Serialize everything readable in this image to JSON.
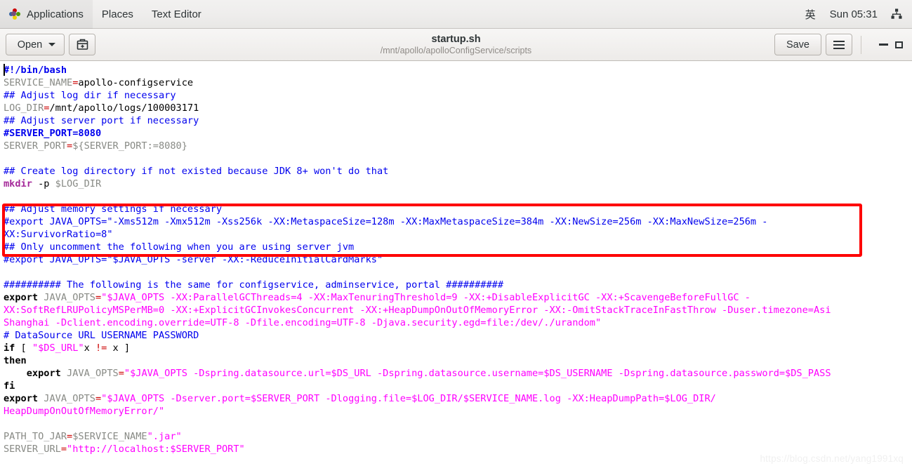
{
  "topbar": {
    "logo_icon": "gnome-footprint-icon",
    "applications": "Applications",
    "places": "Places",
    "app_name": "Text Editor",
    "input_method": "英",
    "clock": "Sun 05:31",
    "network_icon": "network-wired-icon"
  },
  "headerbar": {
    "open_label": "Open",
    "open_caret_icon": "chevron-down-icon",
    "open_recent_icon": "open-recent-document-icon",
    "title": "startup.sh",
    "subtitle": "/mnt/apollo/apolloConfigService/scripts",
    "save_label": "Save",
    "menu_icon": "hamburger-menu-icon",
    "minimize_icon": "minimize-icon",
    "maximize_icon": "maximize-icon"
  },
  "editor": {
    "lines": [
      [
        {
          "t": "#!/bin/bash",
          "c": "cmtb"
        }
      ],
      [
        {
          "t": "SERVICE_NAME",
          "c": "var"
        },
        {
          "t": "=",
          "c": "op"
        },
        {
          "t": "apollo-configservice",
          "c": "plain"
        }
      ],
      [
        {
          "t": "## Adjust log dir if necessary",
          "c": "cmt"
        }
      ],
      [
        {
          "t": "LOG_DIR",
          "c": "var"
        },
        {
          "t": "=",
          "c": "op"
        },
        {
          "t": "/mnt/apollo/logs/100003171",
          "c": "plain"
        }
      ],
      [
        {
          "t": "## Adjust server port if necessary",
          "c": "cmt"
        }
      ],
      [
        {
          "t": "#SERVER_PORT=8080",
          "c": "cmtb"
        }
      ],
      [
        {
          "t": "SERVER_PORT",
          "c": "var"
        },
        {
          "t": "=",
          "c": "op"
        },
        {
          "t": "${SERVER_PORT:=8080}",
          "c": "var"
        }
      ],
      [],
      [
        {
          "t": "## Create log directory if not existed because JDK 8+ won't do that",
          "c": "cmt"
        }
      ],
      [
        {
          "t": "mkdir",
          "c": "bi"
        },
        {
          "t": " -p ",
          "c": "plain"
        },
        {
          "t": "$LOG_DIR",
          "c": "var"
        }
      ],
      [],
      [
        {
          "t": "## Adjust memory settings if necessary",
          "c": "cmt"
        }
      ],
      [
        {
          "t": "#export JAVA_OPTS=\"-Xms512m -Xmx512m -Xss256k -XX:MetaspaceSize=128m -XX:MaxMetaspaceSize=384m -XX:NewSize=256m -XX:MaxNewSize=256m -",
          "c": "cmt"
        }
      ],
      [
        {
          "t": "XX:SurvivorRatio=8\"",
          "c": "cmt"
        }
      ],
      [
        {
          "t": "## Only uncomment the following when you are using server jvm",
          "c": "cmt"
        }
      ],
      [
        {
          "t": "#export JAVA_OPTS=\"$JAVA_OPTS -server -XX:-ReduceInitialCardMarks\"",
          "c": "cmt"
        }
      ],
      [],
      [
        {
          "t": "########## The following is the same for configservice, adminservice, portal ##########",
          "c": "cmt"
        }
      ],
      [
        {
          "t": "export",
          "c": "kw"
        },
        {
          "t": " ",
          "c": "plain"
        },
        {
          "t": "JAVA_OPTS",
          "c": "var"
        },
        {
          "t": "=",
          "c": "op"
        },
        {
          "t": "\"$JAVA_OPTS -XX:ParallelGCThreads=4 -XX:MaxTenuringThreshold=9 -XX:+DisableExplicitGC -XX:+ScavengeBeforeFullGC -",
          "c": "str"
        }
      ],
      [
        {
          "t": "XX:SoftRefLRUPolicyMSPerMB=0 -XX:+ExplicitGCInvokesConcurrent -XX:+HeapDumpOnOutOfMemoryError -XX:-OmitStackTraceInFastThrow -Duser.timezone=Asi",
          "c": "str"
        }
      ],
      [
        {
          "t": "Shanghai -Dclient.encoding.override=UTF-8 -Dfile.encoding=UTF-8 -Djava.security.egd=file:/dev/./urandom\"",
          "c": "str"
        }
      ],
      [
        {
          "t": "# DataSource URL USERNAME PASSWORD",
          "c": "cmt"
        }
      ],
      [
        {
          "t": "if",
          "c": "kw"
        },
        {
          "t": " [ ",
          "c": "plain"
        },
        {
          "t": "\"$DS_URL\"",
          "c": "str"
        },
        {
          "t": "x ",
          "c": "plain"
        },
        {
          "t": "!=",
          "c": "op"
        },
        {
          "t": " x ]",
          "c": "plain"
        }
      ],
      [
        {
          "t": "then",
          "c": "kw"
        }
      ],
      [
        {
          "t": "    export",
          "c": "kw"
        },
        {
          "t": " ",
          "c": "plain"
        },
        {
          "t": "JAVA_OPTS",
          "c": "var"
        },
        {
          "t": "=",
          "c": "op"
        },
        {
          "t": "\"$JAVA_OPTS -Dspring.datasource.url=$DS_URL -Dspring.datasource.username=$DS_USERNAME -Dspring.datasource.password=$DS_PASS",
          "c": "str"
        }
      ],
      [
        {
          "t": "fi",
          "c": "kw"
        }
      ],
      [
        {
          "t": "export",
          "c": "kw"
        },
        {
          "t": " ",
          "c": "plain"
        },
        {
          "t": "JAVA_OPTS",
          "c": "var"
        },
        {
          "t": "=",
          "c": "op"
        },
        {
          "t": "\"$JAVA_OPTS -Dserver.port=$SERVER_PORT -Dlogging.file=$LOG_DIR/$SERVICE_NAME.log -XX:HeapDumpPath=$LOG_DIR/",
          "c": "str"
        }
      ],
      [
        {
          "t": "HeapDumpOnOutOfMemoryError/\"",
          "c": "str"
        }
      ],
      [],
      [
        {
          "t": "PATH_TO_JAR",
          "c": "var"
        },
        {
          "t": "=",
          "c": "op"
        },
        {
          "t": "$SERVICE_NAME",
          "c": "var"
        },
        {
          "t": "\".jar\"",
          "c": "str"
        }
      ],
      [
        {
          "t": "SERVER_URL",
          "c": "var"
        },
        {
          "t": "=",
          "c": "op"
        },
        {
          "t": "\"http://localhost:$SERVER_PORT\"",
          "c": "str"
        }
      ]
    ]
  },
  "annotation": {
    "highlight_color": "#fe0000"
  },
  "watermark": {
    "text": "https://blog.csdn.net/yang1991xq"
  }
}
